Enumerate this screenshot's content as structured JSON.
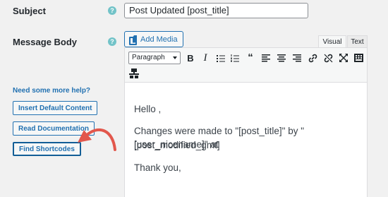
{
  "subject": {
    "label": "Subject",
    "value": "Post Updated [post_title]"
  },
  "message_body": {
    "label": "Message Body"
  },
  "help_icon_glyph": "?",
  "media": {
    "add_media_label": "Add Media"
  },
  "tabs": {
    "visual": "Visual",
    "text": "Text"
  },
  "toolbar": {
    "format_select": "Paragraph",
    "buttons": [
      "bold-icon",
      "italic-icon",
      "bullet-list-icon",
      "numbered-list-icon",
      "blockquote-icon",
      "align-left-icon",
      "align-center-icon",
      "align-right-icon",
      "link-icon",
      "unlink-icon",
      "fullscreen-icon",
      "toolbar-toggle-icon",
      "template-icon"
    ]
  },
  "editor": {
    "line1": "Hello ,",
    "line2": "Changes were made to \"[post_title]\" by \"[user_nicename]\" at",
    "line3": "[post_modified_gmt]",
    "line4": "Thank you,"
  },
  "help": {
    "heading": "Need some more help?",
    "insert_default": "Insert Default Content",
    "read_docs": "Read Documentation",
    "find_shortcodes": "Find Shortcodes"
  },
  "colors": {
    "accent": "#2271b1",
    "arrow": "#e2574c",
    "help_icon": "#72c3c8"
  }
}
